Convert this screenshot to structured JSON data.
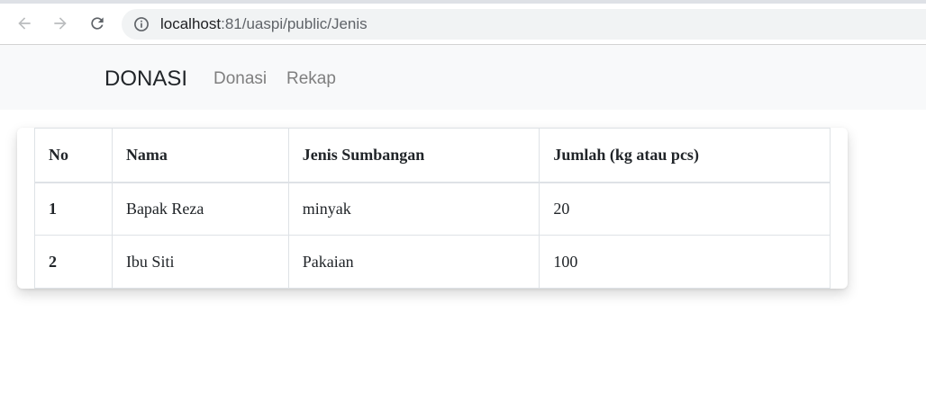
{
  "browser": {
    "url_host": "localhost",
    "url_path": ":81/uaspi/public/Jenis"
  },
  "navbar": {
    "brand": "DONASI",
    "links": [
      "Donasi",
      "Rekap"
    ]
  },
  "table": {
    "headers": [
      "No",
      "Nama",
      "Jenis Sumbangan",
      "Jumlah (kg atau pcs)"
    ],
    "rows": [
      [
        "1",
        "Bapak Reza",
        "minyak",
        "20"
      ],
      [
        "2",
        "Ibu Siti",
        "Pakaian",
        "100"
      ]
    ]
  }
}
